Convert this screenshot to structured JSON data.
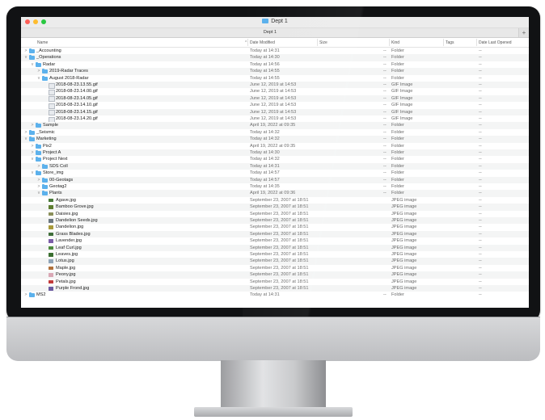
{
  "window": {
    "title": "Dept 1",
    "tab_label": "Dept 1",
    "add_tab_label": "+"
  },
  "columns": {
    "name": "Name",
    "date_modified": "Date Modified",
    "size": "Size",
    "kind": "Kind",
    "tags": "Tags",
    "date_last_opened": "Date Last Opened",
    "sort_indicator": "^"
  },
  "rows": [
    {
      "indent": 0,
      "chevron": ">",
      "icon": "folder",
      "name": "_Accounting",
      "date": "Today at 14:31",
      "size": "--",
      "kind": "Folder",
      "last": "--"
    },
    {
      "indent": 0,
      "chevron": "v",
      "icon": "folder",
      "name": "_Operations",
      "date": "Today at 14:30",
      "size": "--",
      "kind": "Folder",
      "last": "--"
    },
    {
      "indent": 1,
      "chevron": "v",
      "icon": "folder",
      "name": "Radar",
      "date": "Today at 14:56",
      "size": "--",
      "kind": "Folder",
      "last": "--"
    },
    {
      "indent": 2,
      "chevron": ">",
      "icon": "folder",
      "name": "2019-Radar Traces",
      "date": "Today at 14:55",
      "size": "--",
      "kind": "Folder",
      "last": "--"
    },
    {
      "indent": 2,
      "chevron": "v",
      "icon": "folder",
      "name": "August 2018-Radar",
      "date": "Today at 14:55",
      "size": "--",
      "kind": "Folder",
      "last": "--"
    },
    {
      "indent": 3,
      "chevron": "",
      "icon": "gif",
      "name": "2018-08-23.13.55.gif",
      "date": "June 12, 2019 at 14:53",
      "size": "--",
      "kind": "GIF Image",
      "last": "--"
    },
    {
      "indent": 3,
      "chevron": "",
      "icon": "gif",
      "name": "2018-08-23.14.00.gif",
      "date": "June 12, 2019 at 14:53",
      "size": "--",
      "kind": "GIF Image",
      "last": "--"
    },
    {
      "indent": 3,
      "chevron": "",
      "icon": "gif",
      "name": "2018-08-23.14.05.gif",
      "date": "June 12, 2019 at 14:53",
      "size": "--",
      "kind": "GIF Image",
      "last": "--"
    },
    {
      "indent": 3,
      "chevron": "",
      "icon": "gif",
      "name": "2018-08-23.14.10.gif",
      "date": "June 12, 2019 at 14:53",
      "size": "--",
      "kind": "GIF Image",
      "last": "--"
    },
    {
      "indent": 3,
      "chevron": "",
      "icon": "gif",
      "name": "2018-08-23.14.15.gif",
      "date": "June 12, 2019 at 14:53",
      "size": "--",
      "kind": "GIF Image",
      "last": "--"
    },
    {
      "indent": 3,
      "chevron": "",
      "icon": "gif",
      "name": "2018-08-23.14.20.gif",
      "date": "June 12, 2019 at 14:53",
      "size": "--",
      "kind": "GIF Image",
      "last": "--"
    },
    {
      "indent": 1,
      "chevron": ">",
      "icon": "folder",
      "name": "Sample",
      "date": "April 19, 2022 at 09:35",
      "size": "--",
      "kind": "Folder",
      "last": "--"
    },
    {
      "indent": 0,
      "chevron": ">",
      "icon": "folder",
      "name": "_Seismic",
      "date": "Today at 14:32",
      "size": "--",
      "kind": "Folder",
      "last": "--"
    },
    {
      "indent": 0,
      "chevron": "v",
      "icon": "folder",
      "name": "Marketing",
      "date": "Today at 14:32",
      "size": "--",
      "kind": "Folder",
      "last": "--"
    },
    {
      "indent": 1,
      "chevron": ">",
      "icon": "folder",
      "name": "Pix2",
      "date": "April 19, 2022 at 09:35",
      "size": "--",
      "kind": "Folder",
      "last": "--"
    },
    {
      "indent": 1,
      "chevron": ">",
      "icon": "folder",
      "name": "Project A",
      "date": "Today at 14:30",
      "size": "--",
      "kind": "Folder",
      "last": "--"
    },
    {
      "indent": 1,
      "chevron": "v",
      "icon": "folder",
      "name": "Project Next",
      "date": "Today at 14:32",
      "size": "--",
      "kind": "Folder",
      "last": "--"
    },
    {
      "indent": 2,
      "chevron": ">",
      "icon": "folder",
      "name": "SDS Coll",
      "date": "Today at 14:31",
      "size": "--",
      "kind": "Folder",
      "last": "--"
    },
    {
      "indent": 1,
      "chevron": "v",
      "icon": "folder",
      "name": "Store_img",
      "date": "Today at 14:57",
      "size": "--",
      "kind": "Folder",
      "last": "--"
    },
    {
      "indent": 2,
      "chevron": ">",
      "icon": "folder",
      "name": "00-Geotags",
      "date": "Today at 14:57",
      "size": "--",
      "kind": "Folder",
      "last": "--"
    },
    {
      "indent": 2,
      "chevron": ">",
      "icon": "folder",
      "name": "Geotag2",
      "date": "Today at 14:35",
      "size": "--",
      "kind": "Folder",
      "last": "--"
    },
    {
      "indent": 2,
      "chevron": "v",
      "icon": "folder",
      "name": "Plants",
      "date": "April 19, 2022 at 09:36",
      "size": "--",
      "kind": "Folder",
      "last": "--"
    },
    {
      "indent": 3,
      "chevron": "",
      "icon": "jpeg",
      "color": "#4a7a3a",
      "name": "Agave.jpg",
      "date": "September 23, 2007 at 18:51",
      "size": "",
      "kind": "JPEG image",
      "last": "--"
    },
    {
      "indent": 3,
      "chevron": "",
      "icon": "jpeg",
      "color": "#5d7d2f",
      "name": "Bamboo Grove.jpg",
      "date": "September 23, 2007 at 18:51",
      "size": "",
      "kind": "JPEG image",
      "last": "--"
    },
    {
      "indent": 3,
      "chevron": "",
      "icon": "jpeg",
      "color": "#8a8f5a",
      "name": "Daisies.jpg",
      "date": "September 23, 2007 at 18:51",
      "size": "",
      "kind": "JPEG image",
      "last": "--"
    },
    {
      "indent": 3,
      "chevron": "",
      "icon": "jpeg",
      "color": "#6b7780",
      "name": "Dandelion Seeds.jpg",
      "date": "September 23, 2007 at 18:51",
      "size": "",
      "kind": "JPEG image",
      "last": "--"
    },
    {
      "indent": 3,
      "chevron": "",
      "icon": "jpeg",
      "color": "#a89a3a",
      "name": "Dandelion.jpg",
      "date": "September 23, 2007 at 18:51",
      "size": "",
      "kind": "JPEG image",
      "last": "--"
    },
    {
      "indent": 3,
      "chevron": "",
      "icon": "jpeg",
      "color": "#3f6e3a",
      "name": "Grass Blades.jpg",
      "date": "September 23, 2007 at 18:51",
      "size": "",
      "kind": "JPEG image",
      "last": "--"
    },
    {
      "indent": 3,
      "chevron": "",
      "icon": "jpeg",
      "color": "#7b5ea8",
      "name": "Lavender.jpg",
      "date": "September 23, 2007 at 18:51",
      "size": "",
      "kind": "JPEG image",
      "last": "--"
    },
    {
      "indent": 3,
      "chevron": "",
      "icon": "jpeg",
      "color": "#4d8a3c",
      "name": "Leaf Curl.jpg",
      "date": "September 23, 2007 at 18:51",
      "size": "",
      "kind": "JPEG image",
      "last": "--"
    },
    {
      "indent": 3,
      "chevron": "",
      "icon": "jpeg",
      "color": "#3b6f31",
      "name": "Leaves.jpg",
      "date": "September 23, 2007 at 18:51",
      "size": "",
      "kind": "JPEG image",
      "last": "--"
    },
    {
      "indent": 3,
      "chevron": "",
      "icon": "jpeg",
      "color": "#8fa4b8",
      "name": "Lotus.jpg",
      "date": "September 23, 2007 at 18:51",
      "size": "",
      "kind": "JPEG image",
      "last": "--"
    },
    {
      "indent": 3,
      "chevron": "",
      "icon": "jpeg",
      "color": "#b0703a",
      "name": "Maple.jpg",
      "date": "September 23, 2007 at 18:51",
      "size": "",
      "kind": "JPEG image",
      "last": "--"
    },
    {
      "indent": 3,
      "chevron": "",
      "icon": "jpeg",
      "color": "#d9a7b4",
      "name": "Peony.jpg",
      "date": "September 23, 2007 at 18:51",
      "size": "",
      "kind": "JPEG image",
      "last": "--"
    },
    {
      "indent": 3,
      "chevron": "",
      "icon": "jpeg",
      "color": "#c23a3a",
      "name": "Petals.jpg",
      "date": "September 23, 2007 at 18:51",
      "size": "",
      "kind": "JPEG image",
      "last": "--"
    },
    {
      "indent": 3,
      "chevron": "",
      "icon": "jpeg",
      "color": "#6a5aa0",
      "name": "Purple Frond.jpg",
      "date": "September 23, 2007 at 18:51",
      "size": "",
      "kind": "JPEG image",
      "last": "--"
    },
    {
      "indent": 0,
      "chevron": ">",
      "icon": "folder",
      "name": "MS2",
      "date": "Today at 14:31",
      "size": "--",
      "kind": "Folder",
      "last": "--"
    }
  ],
  "colors": {
    "folder": "#5cb1ec",
    "close_light": "#fe5f57",
    "minimize_light": "#febc2e",
    "zoom_light": "#28c840"
  }
}
